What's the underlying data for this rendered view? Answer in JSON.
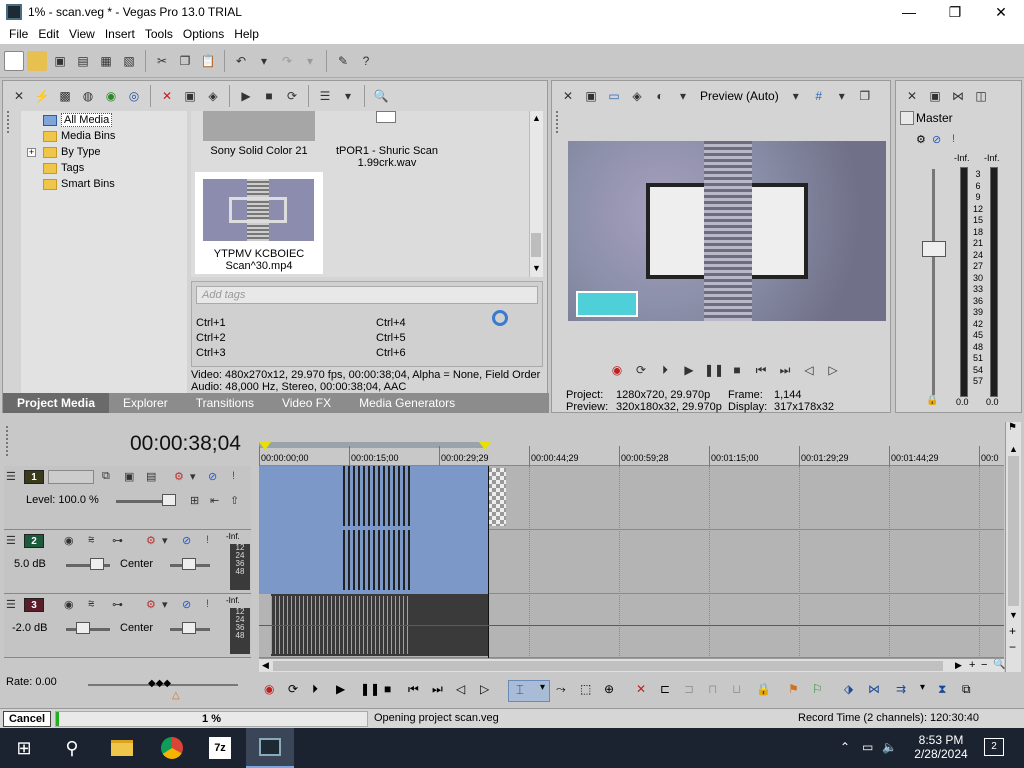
{
  "window": {
    "title": "1% - scan.veg * - Vegas Pro 13.0 TRIAL",
    "minimize_glyph": "—",
    "maximize_glyph": "❐",
    "close_glyph": "✕"
  },
  "menu": [
    "File",
    "Edit",
    "View",
    "Insert",
    "Tools",
    "Options",
    "Help"
  ],
  "media_tree": {
    "items": [
      {
        "label": "All Media",
        "selected": true
      },
      {
        "label": "Media Bins"
      },
      {
        "label": "By Type",
        "expandable": true
      },
      {
        "label": "Tags"
      },
      {
        "label": "Smart Bins"
      }
    ],
    "expand_glyph": "+"
  },
  "media_items": [
    {
      "label": "Sony Solid Color 21"
    },
    {
      "label": "tPOR1 - Shuric Scan 1.99crk.wav"
    },
    {
      "label": "YTPMV KCBOIEC Scan^30.mp4",
      "selected": true
    }
  ],
  "tags": {
    "placeholder": "Add tags",
    "shortcuts": [
      "Ctrl+1",
      "Ctrl+2",
      "Ctrl+3",
      "Ctrl+4",
      "Ctrl+5",
      "Ctrl+6"
    ]
  },
  "media_info": {
    "video": "Video: 480x270x12, 29.970 fps, 00:00:38;04, Alpha = None, Field Order",
    "audio": "Audio: 48,000 Hz, Stereo, 00:00:38;04, AAC"
  },
  "media_tabs": [
    "Project Media",
    "Explorer",
    "Transitions",
    "Video FX",
    "Media Generators"
  ],
  "preview": {
    "mode_label": "Preview (Auto)",
    "project_label": "Project:",
    "project_value": "1280x720, 29.970p",
    "frame_label": "Frame:",
    "frame_value": "1,144",
    "preview_label": "Preview:",
    "preview_value": "320x180x32, 29.970p",
    "display_label": "Display:",
    "display_value": "317x178x32"
  },
  "master": {
    "title": "Master",
    "inf_left": "-Inf.",
    "inf_right": "-Inf.",
    "scale": [
      "3",
      "6",
      "9",
      "12",
      "15",
      "18",
      "21",
      "24",
      "27",
      "30",
      "33",
      "36",
      "39",
      "42",
      "45",
      "48",
      "51",
      "54",
      "57"
    ],
    "level_left": "0.0",
    "level_right": "0.0"
  },
  "timeline": {
    "timecode": "00:00:38;04",
    "ruler": [
      "00:00:00;00",
      "00:00:15;00",
      "00:00:29;29",
      "00:00:44;29",
      "00:00:59;28",
      "00:01:15;00",
      "00:01:29;29",
      "00:01:44;29",
      "00:0"
    ],
    "tracks": [
      {
        "num": "1",
        "color": "#d8d020",
        "level_label": "Level: 100.0 %"
      },
      {
        "num": "2",
        "color": "#2a8a5a",
        "volume": "5.0 dB",
        "pan": "Center",
        "meter_inf": "-Inf.",
        "meter_scale": [
          "12",
          "24",
          "36",
          "48"
        ]
      },
      {
        "num": "3",
        "color": "#8a2a3a",
        "volume": "-2.0 dB",
        "pan": "Center",
        "meter_inf": "-Inf.",
        "meter_scale": [
          "12",
          "24",
          "36",
          "48"
        ]
      }
    ],
    "rate_label": "Rate: 0.00"
  },
  "status": {
    "cancel_label": "Cancel",
    "progress_text": "1 %",
    "progress_fraction": 0.01,
    "message": "Opening project scan.veg",
    "record_time": "Record Time (2 channels): 120:30:40"
  },
  "taskbar": {
    "time": "8:53 PM",
    "date": "2/28/2024",
    "notification_count": "2",
    "app_7z": "7z"
  },
  "colors": {
    "accent_blue": "#7c98c8",
    "progress_green": "#20b020",
    "playhead_yellow": "#e8e000"
  }
}
